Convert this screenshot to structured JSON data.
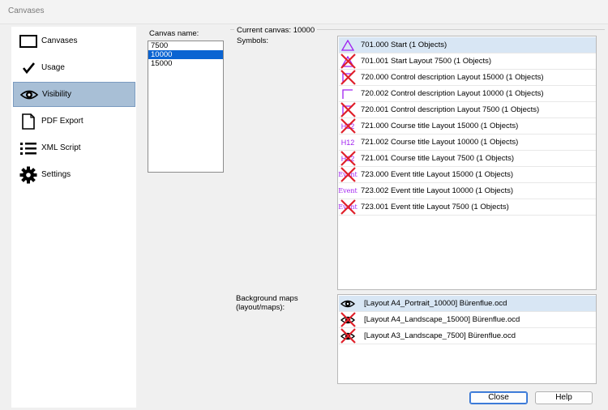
{
  "window": {
    "title": "Canvases"
  },
  "sidebar": {
    "items": [
      {
        "label": "Canvases",
        "icon": "rectangle-icon"
      },
      {
        "label": "Usage",
        "icon": "checkmark-icon"
      },
      {
        "label": "Visibility",
        "icon": "eye-icon"
      },
      {
        "label": "PDF Export",
        "icon": "document-icon"
      },
      {
        "label": "XML Script",
        "icon": "list-icon"
      },
      {
        "label": "Settings",
        "icon": "gear-icon"
      }
    ],
    "selected": "Visibility"
  },
  "canvas_name": {
    "label": "Canvas name:",
    "options": [
      "7500",
      "10000",
      "15000"
    ],
    "selected": "10000"
  },
  "current_canvas": "Current canvas: 10000",
  "symbols": {
    "label": "Symbols:",
    "items": [
      {
        "text": "701.000 Start (1 Objects)",
        "hidden": false
      },
      {
        "text": "701.001 Start Layout 7500 (1 Objects)",
        "hidden": true
      },
      {
        "text": "720.000 Control description Layout 15000 (1 Objects)",
        "hidden": true
      },
      {
        "text": "720.002 Control description Layout 10000 (1 Objects)",
        "hidden": false
      },
      {
        "text": "720.001 Control description Layout 7500 (1 Objects)",
        "hidden": true
      },
      {
        "text": "721.000 Course title Layout 15000 (1 Objects)",
        "hidden": true
      },
      {
        "text": "721.002 Course title Layout 10000 (1 Objects)",
        "hidden": false
      },
      {
        "text": "721.001 Course title Layout 7500 (1 Objects)",
        "hidden": true
      },
      {
        "text": "723.000 Event title Layout 15000 (1 Objects)",
        "hidden": true
      },
      {
        "text": "723.002 Event title Layout 10000 (1 Objects)",
        "hidden": false
      },
      {
        "text": "723.001 Event title Layout 7500 (1 Objects)",
        "hidden": true
      }
    ],
    "icon_text": {
      "course": "H12",
      "event": "Event"
    }
  },
  "background_maps": {
    "label_line1": "Background maps",
    "label_line2": "(layout/maps):",
    "items": [
      {
        "text": "[Layout A4_Portrait_10000] Bürenflue.ocd",
        "hidden": false
      },
      {
        "text": "[Layout A4_Landscape_15000] Bürenflue.ocd",
        "hidden": true
      },
      {
        "text": "[Layout A3_Landscape_7500] Bürenflue.ocd",
        "hidden": true
      }
    ]
  },
  "buttons": {
    "close": "Close",
    "help": "Help"
  },
  "colors": {
    "symbol_purple": "#a020f0",
    "hidden_cross": "#e0202a",
    "selection_blue": "#0a64d2",
    "sidebar_selected": "#a8bfd6"
  }
}
